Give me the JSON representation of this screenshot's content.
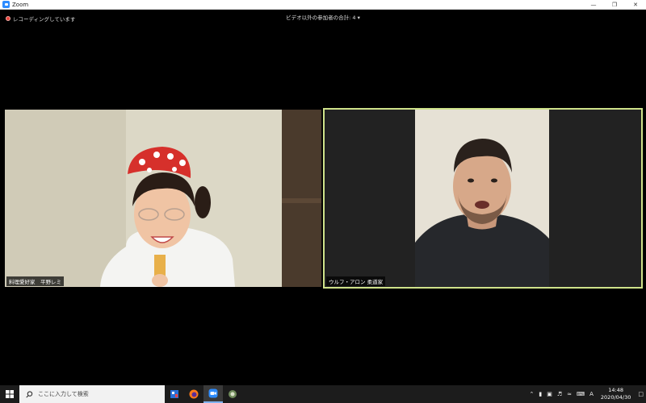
{
  "window": {
    "title": "Zoom"
  },
  "meeting": {
    "recording_label": "レコーディングしています",
    "participants_label": "ビデオ以外の参加者の合計: 4"
  },
  "tiles": [
    {
      "name": "料理愛好家　平野レミ"
    },
    {
      "name": "ウルフ・アロン 柔道家"
    }
  ],
  "taskbar": {
    "search_placeholder": "ここに入力して検索",
    "time": "14:48",
    "date": "2020/04/30",
    "lang": "A"
  },
  "colors": {
    "zoom_blue": "#2d8cff",
    "active_speaker_border": "#cfe28a",
    "record_red": "#e8423a"
  }
}
